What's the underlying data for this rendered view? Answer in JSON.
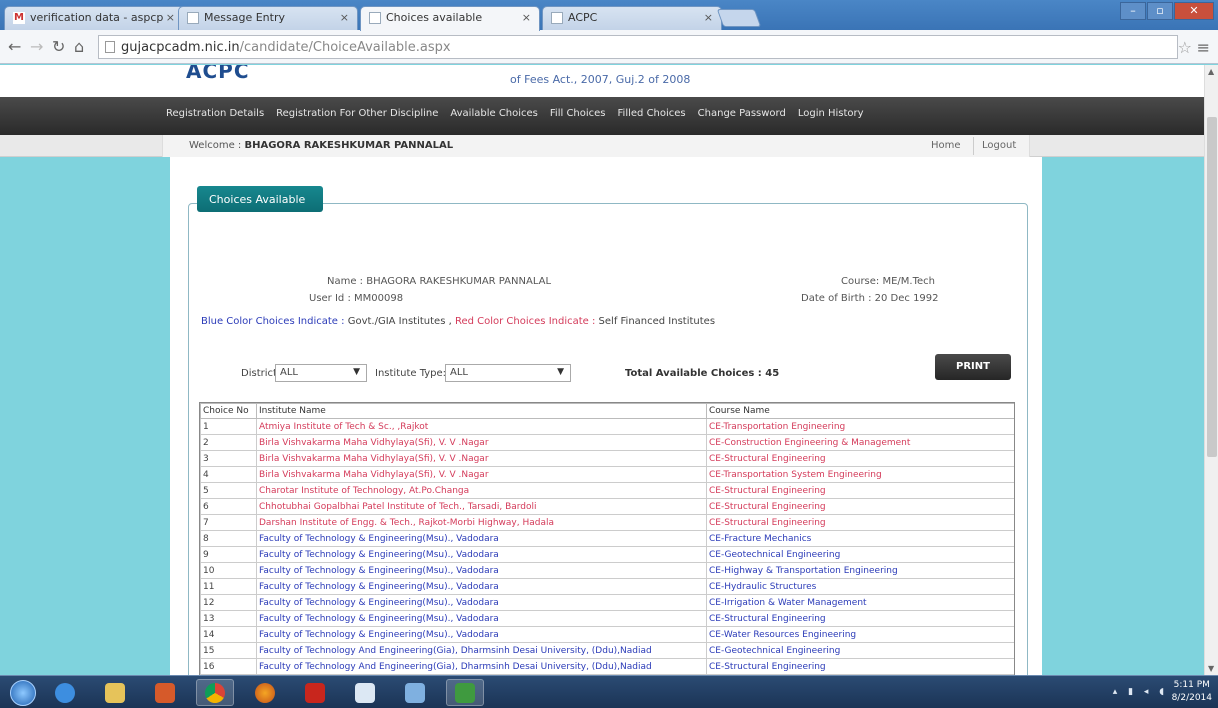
{
  "browser": {
    "tabs": [
      {
        "title": "verification data - aspcp",
        "icon": "gmail-icon"
      },
      {
        "title": "Message Entry",
        "icon": "page-icon"
      },
      {
        "title": "Choices available",
        "icon": "page-icon"
      },
      {
        "title": "ACPC",
        "icon": "page-icon"
      }
    ],
    "url_host": "gujacpcadm.nic.in",
    "url_path": "/candidate/ChoiceAvailable.aspx"
  },
  "site": {
    "logo": "ACPC",
    "act_text": "of Fees Act., 2007, Guj.2 of 2008"
  },
  "menu": [
    "Registration Details",
    "Registration For Other Discipline",
    "Available Choices",
    "Fill Choices",
    "Filled Choices",
    "Change Password",
    "Login History"
  ],
  "welcome": {
    "prefix": "Welcome :",
    "name": "BHAGORA RAKESHKUMAR PANNALAL",
    "home": "Home",
    "logout": "Logout"
  },
  "panel": {
    "title": "Choices Available",
    "name_line": "Name : BHAGORA RAKESHKUMAR PANNALAL",
    "userid_line": "User Id : MM00098",
    "course_line": "Course: ME/M.Tech",
    "dob_line": "Date of Birth : 20 Dec 1992",
    "legend_blue": "Blue Color Choices Indicate :",
    "legend_blue_val": "Govt./GIA Institutes ,",
    "legend_red": "Red Color Choices Indicate :",
    "legend_red_val": "Self Financed Institutes",
    "district_label": "District:",
    "district_value": "ALL",
    "insttype_label": "Institute Type:",
    "insttype_value": "ALL",
    "total": "Total Available Choices : 45",
    "print": "PRINT"
  },
  "table": {
    "headers": [
      "Choice No",
      "Institute Name",
      "Course Name"
    ],
    "rows": [
      {
        "no": "1",
        "inst": "Atmiya Institute of Tech & Sc., ,Rajkot",
        "course": "CE-Transportation Engineering",
        "type": "self"
      },
      {
        "no": "2",
        "inst": "Birla Vishvakarma Maha Vidhylaya(Sfi), V. V .Nagar",
        "course": "CE-Construction Engineering & Management",
        "type": "self"
      },
      {
        "no": "3",
        "inst": "Birla Vishvakarma Maha Vidhylaya(Sfi), V. V .Nagar",
        "course": "CE-Structural Engineering",
        "type": "self"
      },
      {
        "no": "4",
        "inst": "Birla Vishvakarma Maha Vidhylaya(Sfi), V. V .Nagar",
        "course": "CE-Transportation System Engineering",
        "type": "self"
      },
      {
        "no": "5",
        "inst": "Charotar Institute of Technology, At.Po.Changa",
        "course": "CE-Structural Engineering",
        "type": "self"
      },
      {
        "no": "6",
        "inst": "Chhotubhai Gopalbhai Patel Institute of Tech., Tarsadi, Bardoli",
        "course": "CE-Structural Engineering",
        "type": "self"
      },
      {
        "no": "7",
        "inst": "Darshan Institute of Engg. & Tech., Rajkot-Morbi Highway, Hadala",
        "course": "CE-Structural Engineering",
        "type": "self"
      },
      {
        "no": "8",
        "inst": "Faculty of Technology & Engineering(Msu)., Vadodara",
        "course": "CE-Fracture Mechanics",
        "type": "govt"
      },
      {
        "no": "9",
        "inst": "Faculty of Technology & Engineering(Msu)., Vadodara",
        "course": "CE-Geotechnical Engineering",
        "type": "govt"
      },
      {
        "no": "10",
        "inst": "Faculty of Technology & Engineering(Msu)., Vadodara",
        "course": "CE-Highway & Transportation Engineering",
        "type": "govt"
      },
      {
        "no": "11",
        "inst": "Faculty of Technology & Engineering(Msu)., Vadodara",
        "course": "CE-Hydraulic Structures",
        "type": "govt"
      },
      {
        "no": "12",
        "inst": "Faculty of Technology & Engineering(Msu)., Vadodara",
        "course": "CE-Irrigation & Water Management",
        "type": "govt"
      },
      {
        "no": "13",
        "inst": "Faculty of Technology & Engineering(Msu)., Vadodara",
        "course": "CE-Structural Engineering",
        "type": "govt"
      },
      {
        "no": "14",
        "inst": "Faculty of Technology & Engineering(Msu)., Vadodara",
        "course": "CE-Water Resources Engineering",
        "type": "govt"
      },
      {
        "no": "15",
        "inst": "Faculty of Technology And Engineering(Gia), Dharmsinh Desai University, (Ddu),Nadiad",
        "course": "CE-Geotechnical Engineering",
        "type": "govt"
      },
      {
        "no": "16",
        "inst": "Faculty of Technology And Engineering(Gia), Dharmsinh Desai University, (Ddu),Nadiad",
        "course": "CE-Structural Engineering",
        "type": "govt"
      }
    ]
  },
  "taskbar": {
    "time": "5:11 PM",
    "date": "8/2/2014"
  }
}
